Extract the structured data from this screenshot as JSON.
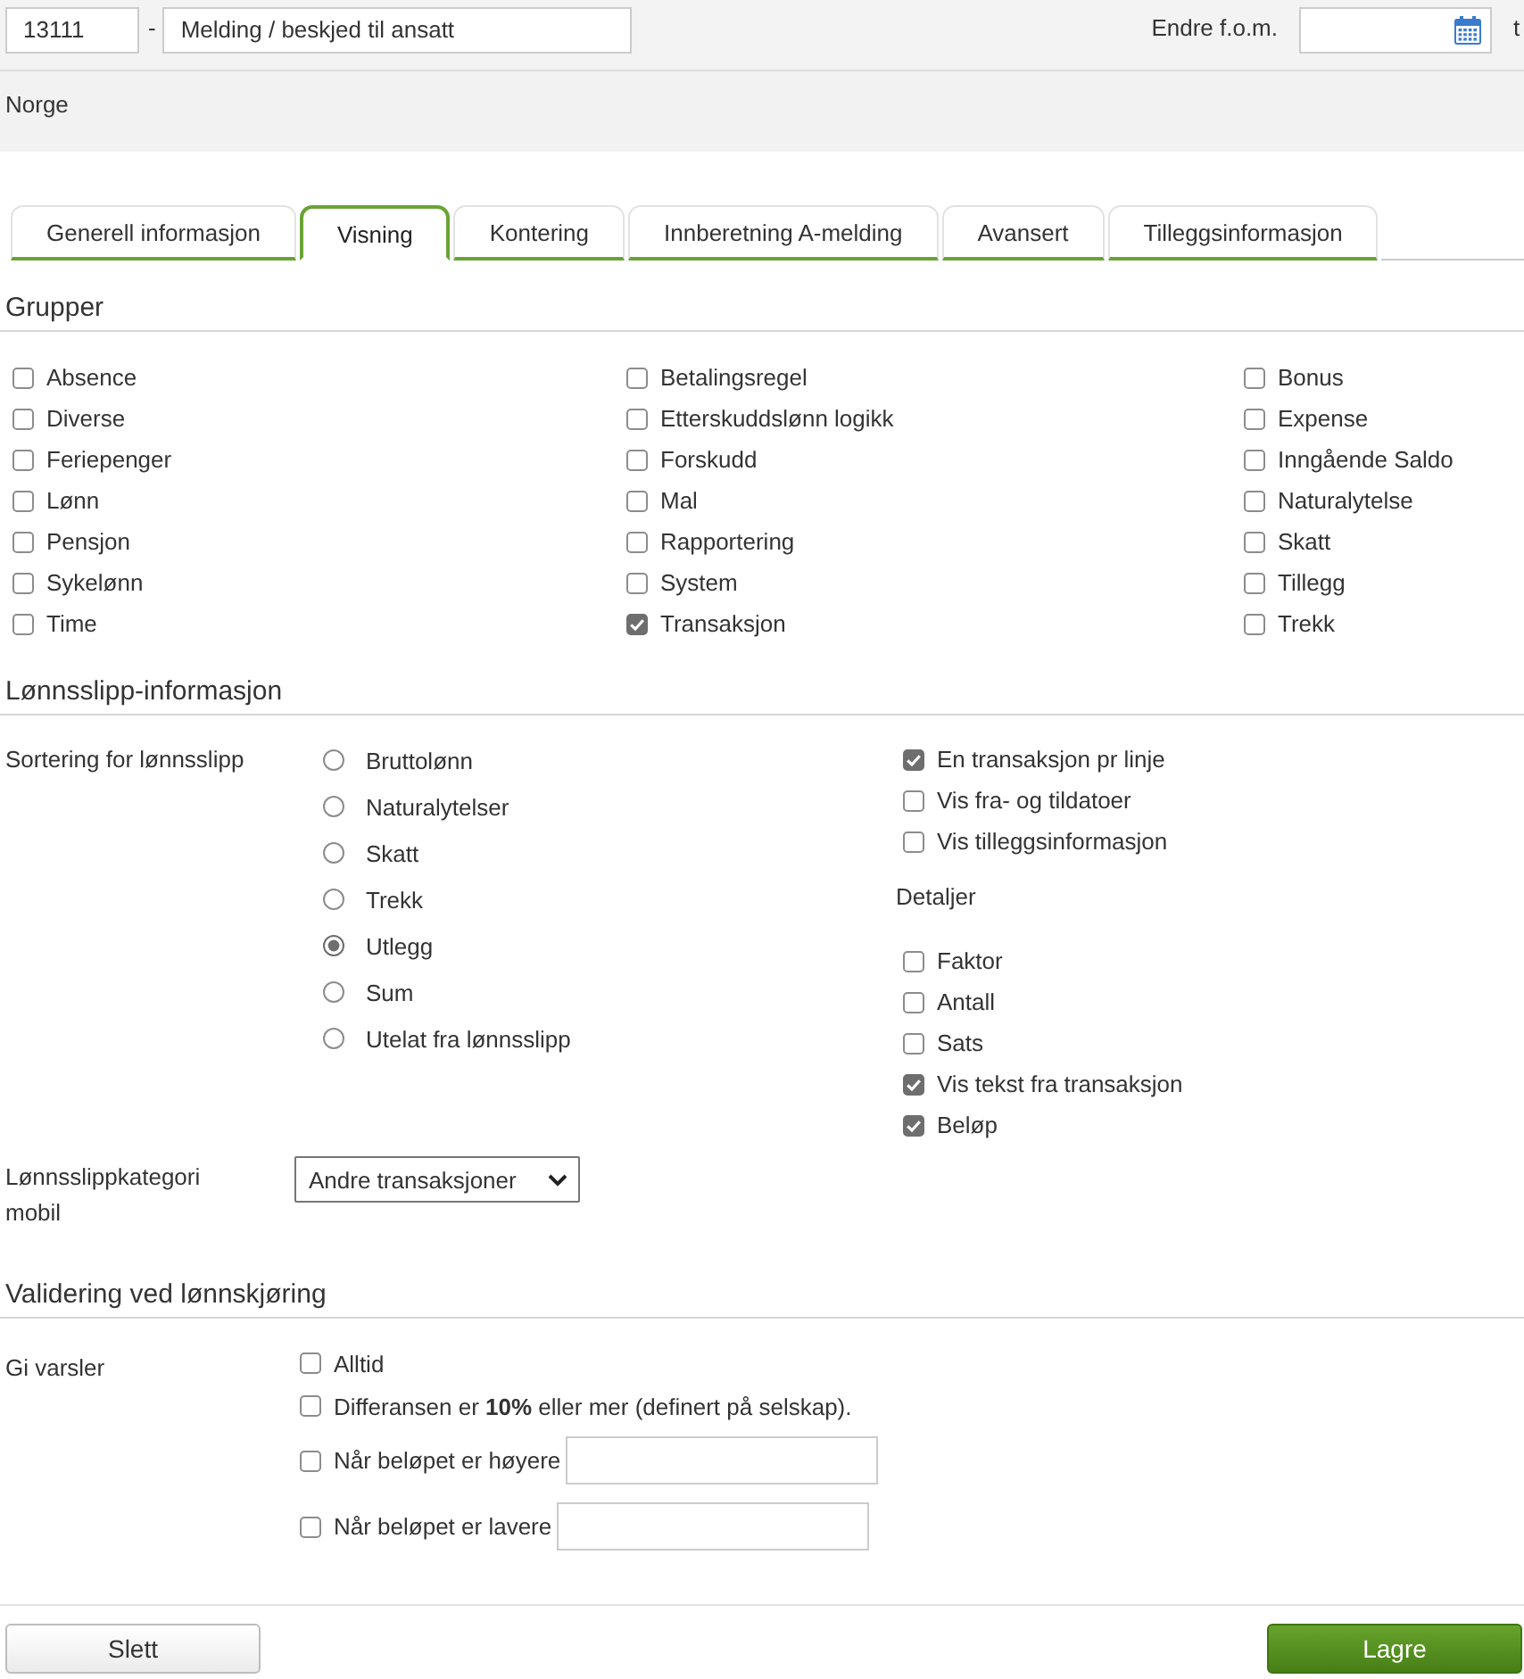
{
  "header": {
    "code": "13111",
    "separator": "-",
    "name": "Melding / beskjed til ansatt",
    "date_label": "Endre f.o.m.",
    "cut_label": "t"
  },
  "country": "Norge",
  "tabs": [
    {
      "label": "Generell informasjon",
      "selected": false
    },
    {
      "label": "Visning",
      "selected": true
    },
    {
      "label": "Kontering",
      "selected": false
    },
    {
      "label": "Innberetning A-melding",
      "selected": false
    },
    {
      "label": "Avansert",
      "selected": false
    },
    {
      "label": "Tilleggsinformasjon",
      "selected": false
    }
  ],
  "groups": {
    "title": "Grupper",
    "columns": [
      {
        "items": [
          {
            "label": "Absence",
            "checked": false
          },
          {
            "label": "Diverse",
            "checked": false
          },
          {
            "label": "Feriepenger",
            "checked": false
          },
          {
            "label": "Lønn",
            "checked": false
          },
          {
            "label": "Pensjon",
            "checked": false
          },
          {
            "label": "Sykelønn",
            "checked": false
          },
          {
            "label": "Time",
            "checked": false
          }
        ]
      },
      {
        "items": [
          {
            "label": "Betalingsregel",
            "checked": false
          },
          {
            "label": "Etterskuddslønn logikk",
            "checked": false
          },
          {
            "label": "Forskudd",
            "checked": false
          },
          {
            "label": "Mal",
            "checked": false
          },
          {
            "label": "Rapportering",
            "checked": false
          },
          {
            "label": "System",
            "checked": false
          },
          {
            "label": "Transaksjon",
            "checked": true
          }
        ]
      },
      {
        "items": [
          {
            "label": "Bonus",
            "checked": false
          },
          {
            "label": "Expense",
            "checked": false
          },
          {
            "label": "Inngående Saldo",
            "checked": false
          },
          {
            "label": "Naturalytelse",
            "checked": false
          },
          {
            "label": "Skatt",
            "checked": false
          },
          {
            "label": "Tillegg",
            "checked": false
          },
          {
            "label": "Trekk",
            "checked": false
          }
        ]
      }
    ]
  },
  "payslip": {
    "title": "Lønnsslipp-informasjon",
    "sort_label": "Sortering for lønnsslipp",
    "sort_options": [
      {
        "label": "Bruttolønn",
        "selected": false
      },
      {
        "label": "Naturalytelser",
        "selected": false
      },
      {
        "label": "Skatt",
        "selected": false
      },
      {
        "label": "Trekk",
        "selected": false
      },
      {
        "label": "Utlegg",
        "selected": true
      },
      {
        "label": "Sum",
        "selected": false
      },
      {
        "label": "Utelat fra lønnsslipp",
        "selected": false
      }
    ],
    "options": [
      {
        "label": "En transaksjon pr linje",
        "checked": true
      },
      {
        "label": "Vis fra- og tildatoer",
        "checked": false
      },
      {
        "label": "Vis tilleggsinformasjon",
        "checked": false
      }
    ],
    "details_label": "Detaljer",
    "details": [
      {
        "label": "Faktor",
        "checked": false
      },
      {
        "label": "Antall",
        "checked": false
      },
      {
        "label": "Sats",
        "checked": false
      },
      {
        "label": "Vis tekst fra transaksjon",
        "checked": true
      },
      {
        "label": "Beløp",
        "checked": true
      }
    ],
    "category_label": "Lønnsslippkategori mobil",
    "category_value": "Andre transaksjoner"
  },
  "validation": {
    "title": "Validering ved lønnskjøring",
    "label": "Gi varsler",
    "options": [
      {
        "kind": "check",
        "label": "Alltid",
        "checked": false
      },
      {
        "kind": "check",
        "label": "Differansen er **10%** eller mer (definert på selskap).",
        "checked": false
      },
      {
        "kind": "amount",
        "label": "Når beløpet er høyere",
        "checked": false
      },
      {
        "kind": "amount",
        "label": "Når beløpet er lavere",
        "checked": false
      }
    ]
  },
  "buttons": [
    {
      "kind": "secondary",
      "label": "Slett"
    },
    {
      "kind": "primary",
      "label": "Lagre"
    }
  ]
}
